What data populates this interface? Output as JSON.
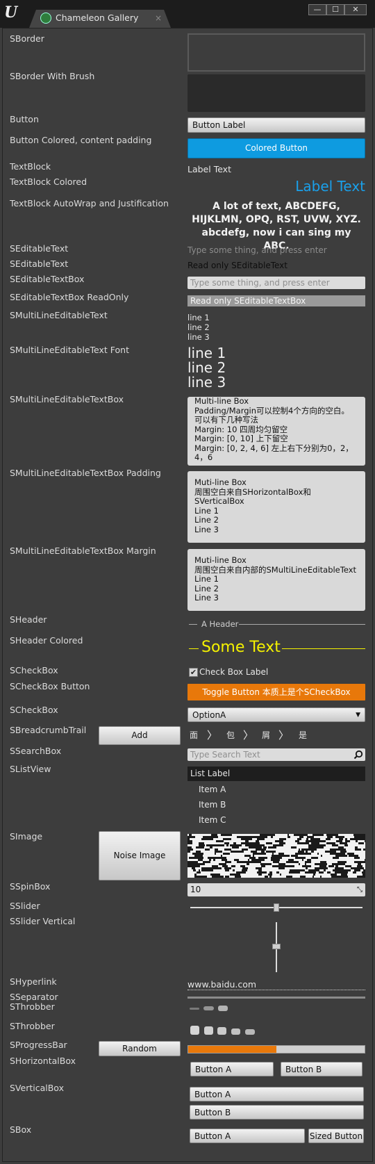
{
  "window": {
    "tab_title": "Chameleon Gallery",
    "tab_close": "×",
    "app_logo": "U",
    "minimize": "—",
    "maximize": "☐",
    "close": "✕"
  },
  "labels": {
    "sborder": "SBorder",
    "sborder_brush": "SBorder With Brush",
    "button": "Button",
    "button_colored": "Button Colored, content padding",
    "textblock": "TextBlock",
    "textblock_colored": "TextBlock Colored",
    "textblock_autowrap": "TextBlock AutoWrap and Justification",
    "seditabletext1": "SEditableText",
    "seditabletext2": "SEditableText",
    "seditabletextbox": "SEditableTextBox",
    "seditabletextbox_ro": "SEditableTextBox ReadOnly",
    "smultiline": "SMultiLineEditableText",
    "smultiline_font": "SMultiLineEditableText Font",
    "smultiline_box": "SMultiLineEditableTextBox",
    "smultiline_box_padding": "SMultiLineEditableTextBox Padding",
    "smultiline_box_margin": "SMultiLineEditableTextBox Margin",
    "sheader": "SHeader",
    "sheader_colored": "SHeader Colored",
    "scheckbox": "SCheckBox",
    "scheckbox_button": "SCheckBox Button",
    "scheckbox2": "SCheckBox",
    "sbreadcrumb": "SBreadcrumbTrail",
    "ssearchbox": "SSearchBox",
    "slistview": "SListView",
    "simage": "SImage",
    "sspinbox": "SSpinBox",
    "sslider": "SSlider",
    "sslider_vertical": "SSlider Vertical",
    "shyperlink": "SHyperlink",
    "sseparator": "SSeparator",
    "sthrobber1": "SThrobber",
    "sthrobber2": "SThrobber",
    "sprogressbar": "SProgressBar",
    "shorizontalbox": "SHorizontalBox",
    "sverticalbox": "SVerticalBox",
    "sbox": "SBox"
  },
  "widgets": {
    "button_label": "Button Label",
    "colored_button": "Colored Button",
    "label_text": "Label Text",
    "label_text_colored": "Label Text",
    "autowrap_text": "A lot of text, ABCDEFG, HIJKLMN, OPQ, RST, UVW, XYZ. abcdefg, now i can sing my ABC.",
    "editable_hint": "Type some thing, and press enter",
    "editable_readonly": "Read only SEditableText",
    "textbox_hint": "Type some thing, and press enter",
    "textbox_readonly": "Read only SEditableTextBox",
    "multiline_text": "line 1\nline 2\nline 3",
    "multiline_font_text": "line 1\nline 2\nline 3",
    "multiline_box": "Multi-line Box\nPadding/Margin可以控制4个方向的空白。\n可以有下几种写法\nMargin: 10 四周均匀留空\nMargin: [0, 10] 上下留空\nMargin: [0, 2, 4, 6] 左上右下分别为0，2，\n4，6",
    "multiline_box_padding": "Muti-line Box\n周围空白来自SHorizontalBox和\nSVerticalBox\nLine 1\nLine 2\nLine 3",
    "multiline_box_margin": "Muti-line Box\n周围空白来自内部的SMultiLineEditableText\nLine 1\nLine 2\nLine 3",
    "header": "A Header",
    "header_colored": "Some Text",
    "checkbox_label": "Check Box Label",
    "toggle_button": "Toggle Button 本质上是个SCheckBox",
    "combo_selected": "OptionA",
    "add_button": "Add",
    "breadcrumbs": [
      "面",
      "包",
      "屑",
      "是"
    ],
    "search_hint": "Type Search Text",
    "list_header": "List Label",
    "list_items": [
      "Item A",
      "Item B",
      "Item C"
    ],
    "noise_button": "Noise Image",
    "spin_value": "10",
    "hyperlink": "www.baidu.com",
    "random_button": "Random",
    "progress": 0.5,
    "hbox_a": "Button A",
    "hbox_b": "Button B",
    "vbox_a": "Button A",
    "vbox_b": "Button B",
    "sbox_a": "Button A",
    "sbox_sized": "Sized Button"
  },
  "colors": {
    "accent_blue": "#0e9be0",
    "label_blue": "#1aa0ea",
    "yellow": "#f5f200",
    "orange": "#e8780a"
  }
}
